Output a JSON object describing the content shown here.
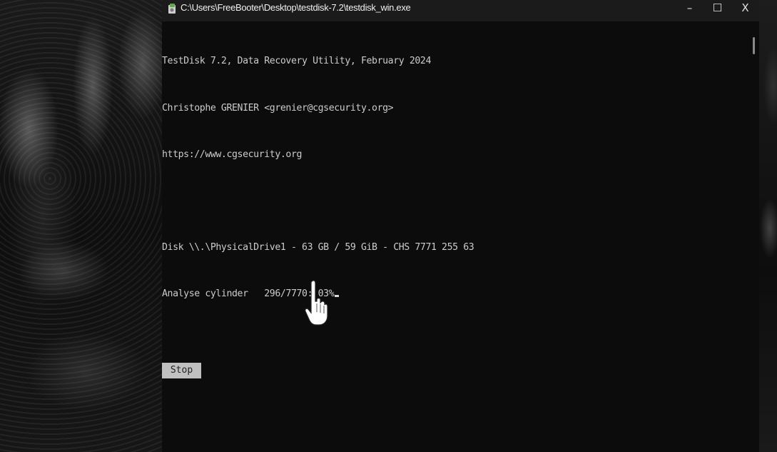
{
  "window": {
    "title": "C:\\Users\\FreeBooter\\Desktop\\testdisk-7.2\\testdisk_win.exe",
    "controls": {
      "minimize": "–",
      "maximize": "☐",
      "close": "X"
    }
  },
  "console": {
    "lines": [
      "TestDisk 7.2, Data Recovery Utility, February 2024",
      "Christophe GRENIER <grenier@cgsecurity.org>",
      "https://www.cgsecurity.org",
      "",
      "Disk \\\\.\\PhysicalDrive1 - 63 GB / 59 GiB - CHS 7771 255 63",
      "Analyse cylinder   296/7770: 03%"
    ]
  },
  "actions": {
    "stop_label": "Stop"
  },
  "icons": {
    "app": "testdisk-app-icon",
    "pointer": "hand-pointer-icon"
  },
  "colors": {
    "console_bg": "#0c0c0c",
    "console_text": "#cccccc",
    "titlebar_bg": "#1b1b1b",
    "stop_button_bg": "#c0c0c0"
  }
}
